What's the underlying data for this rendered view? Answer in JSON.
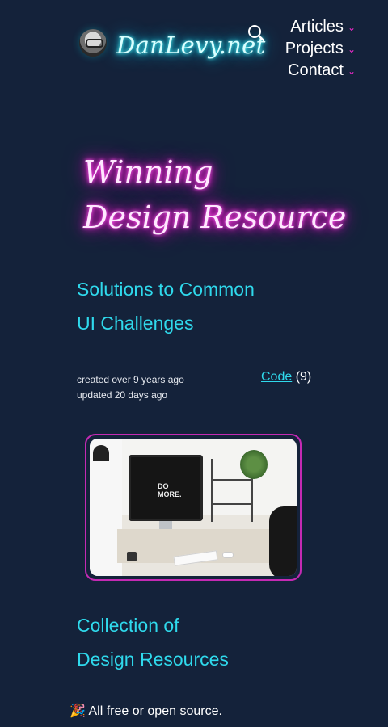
{
  "header": {
    "site_name": "DanLevy.net",
    "nav": [
      {
        "label": "Articles"
      },
      {
        "label": "Projects"
      },
      {
        "label": "Contact"
      }
    ],
    "chevron": "⌄"
  },
  "hero": {
    "title_line1": "Winning",
    "title_line2": "Design Resource"
  },
  "article": {
    "title_line1": "Solutions to Common",
    "title_line2": "UI Challenges",
    "created": "created over 9 years ago",
    "updated": "updated 20 days ago",
    "tag_label": "Code",
    "tag_count": "(9)",
    "image_caption": "DO MORE."
  },
  "section2": {
    "title_line1": "Collection of",
    "title_line2": "Design Resources",
    "note": "🎉 All free or open source."
  },
  "colors": {
    "background": "#14223a",
    "accent_cyan": "#2fd9ec",
    "accent_magenta": "#ff2bd6"
  }
}
